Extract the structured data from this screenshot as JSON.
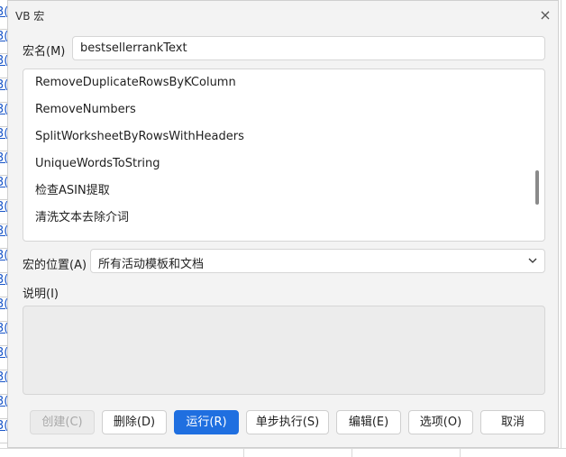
{
  "dialog": {
    "title": "VB 宏",
    "close_glyph": "×",
    "macro_name_label": "宏名(M)",
    "macro_name_value": "bestsellerrankText",
    "macro_list": [
      "RemoveDuplicateRowsByKColumn",
      "RemoveNumbers",
      "SplitWorksheetByRowsWithHeaders",
      "UniqueWordsToString",
      "检查ASIN提取",
      "清洗文本去除介词"
    ],
    "location_label": "宏的位置(A)",
    "location_value": "所有活动模板和文档",
    "description_label": "说明(I)",
    "buttons": {
      "create": "创建(C)",
      "delete": "删除(D)",
      "run": "运行(R)",
      "step": "单步执行(S)",
      "edit": "编辑(E)",
      "options": "选项(O)",
      "cancel": "取消"
    }
  },
  "background": {
    "cell_text": "3("
  },
  "colors": {
    "primary_button": "#1f6fe0",
    "dialog_bg": "#f3f3f3",
    "link_text": "#1a56c8"
  },
  "icons": {
    "close": "close-icon",
    "dropdown": "chevron-down-icon"
  }
}
